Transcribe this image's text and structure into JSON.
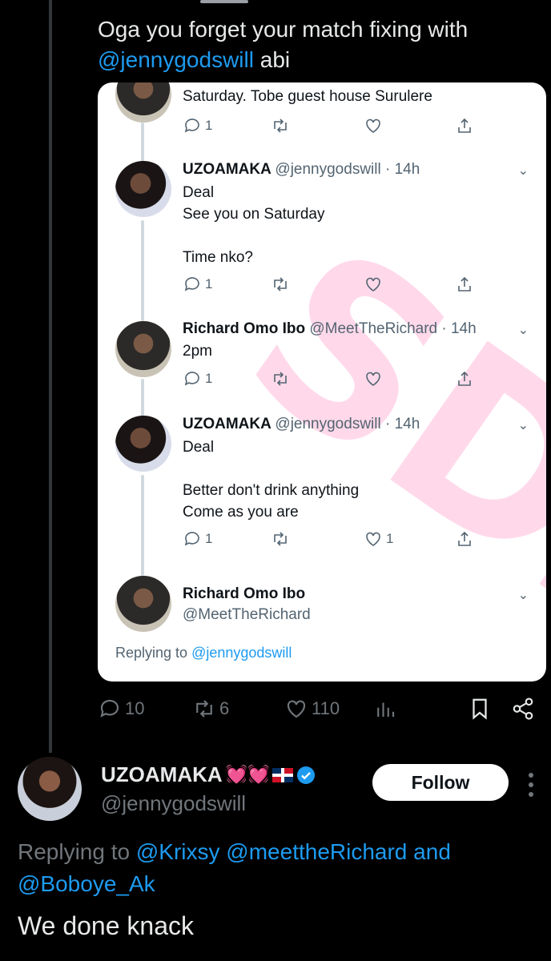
{
  "tweet": {
    "text_prefix": "Oga you forget your match fixing with ",
    "mention": "@jennygodswill",
    "text_suffix": " abi"
  },
  "embedded": {
    "top_fragment": {
      "text": "Saturday. Tobe guest house Surulere",
      "replies": "1"
    },
    "tweets": [
      {
        "name": "UZOAMAKA",
        "meta": "@jennygodswill · 14h",
        "lines": [
          "Deal",
          "See you on Saturday",
          "",
          "Time nko?"
        ],
        "replies": "1",
        "likes": ""
      },
      {
        "name": "Richard Omo Ibo",
        "meta": "@MeetTheRichard · 14h",
        "lines": [
          "2pm"
        ],
        "replies": "1",
        "likes": ""
      },
      {
        "name": "UZOAMAKA",
        "meta": "@jennygodswill · 14h",
        "lines": [
          "Deal",
          "",
          "Better don't drink anything",
          "Come as you are"
        ],
        "replies": "1",
        "likes": "1"
      }
    ],
    "last": {
      "name": "Richard Omo Ibo",
      "handle": "@MeetTheRichard"
    },
    "replying_label": "Replying to",
    "replying_mention": "@jennygodswill",
    "watermark": "SDZ"
  },
  "main_actions": {
    "replies": "10",
    "retweets": "6",
    "likes": "110"
  },
  "reply": {
    "name": "UZOAMAKA",
    "emojis": "💓💓",
    "handle": "@jennygodswill",
    "follow_label": "Follow",
    "replying_label": "Replying to",
    "replying_mentions": "@Krixsy @meettheRichard",
    "replying_and": "and",
    "replying_last": "@Boboye_Ak",
    "text": "We done knack"
  },
  "colors": {
    "accent": "#1d9bf0",
    "background": "#000000",
    "muted": "#71767b"
  }
}
